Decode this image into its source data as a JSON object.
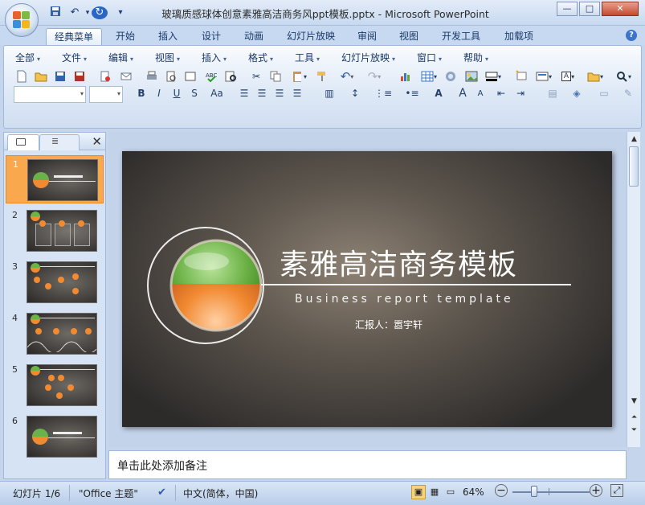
{
  "window": {
    "title": "玻璃质感球体创意素雅高洁商务风ppt模板.pptx - Microsoft PowerPoint",
    "controls": {
      "minimize": "—",
      "maximize": "□",
      "close": "✕"
    }
  },
  "quick_access": {
    "save_icon": "save-icon",
    "undo_icon": "undo-icon",
    "redo_icon": "redo-icon",
    "more": "▾"
  },
  "ribbon_tabs": [
    "经典菜单",
    "开始",
    "插入",
    "设计",
    "动画",
    "幻灯片放映",
    "审阅",
    "视图",
    "开发工具",
    "加载项"
  ],
  "active_tab": "经典菜单",
  "classic_menu": [
    "全部",
    "文件",
    "编辑",
    "视图",
    "插入",
    "格式",
    "工具",
    "幻灯片放映",
    "窗口",
    "帮助"
  ],
  "format_bar": {
    "bold": "B",
    "italic": "I",
    "underline": "U",
    "strike": "S",
    "case": "Aa",
    "font_color": "A",
    "grow": "A",
    "shrink": "A"
  },
  "panel": {
    "close": "✕"
  },
  "slides": [
    {
      "num": "1",
      "selected": true
    },
    {
      "num": "2",
      "selected": false
    },
    {
      "num": "3",
      "selected": false
    },
    {
      "num": "4",
      "selected": false
    },
    {
      "num": "5",
      "selected": false
    },
    {
      "num": "6",
      "selected": false
    }
  ],
  "slide": {
    "title": "素雅高洁商务模板",
    "subtitle": "Business report template",
    "reporter": "汇报人：嚣宇轩",
    "colors": {
      "green": "#6bb145",
      "orange": "#f1822e"
    }
  },
  "notes_placeholder": "单击此处添加备注",
  "status": {
    "slide_indicator": "幻灯片 1/6",
    "theme": "\"Office 主题\"",
    "language": "中文(简体，中国)",
    "zoom": "64%",
    "zoom_level": 0.64
  }
}
